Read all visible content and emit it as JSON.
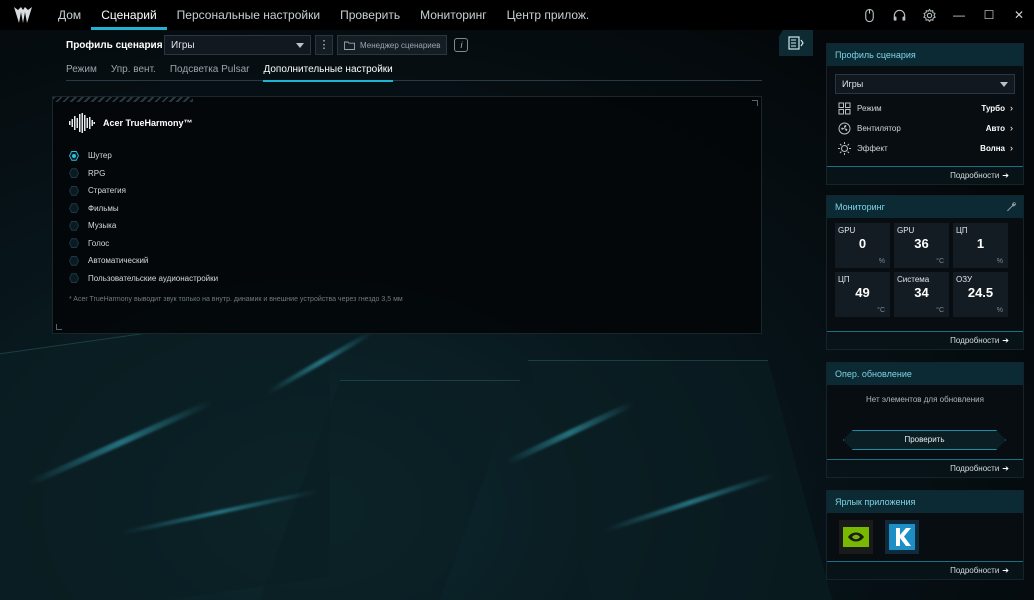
{
  "nav": {
    "items": [
      {
        "label": "Дом",
        "active": false
      },
      {
        "label": "Сценарий",
        "active": true
      },
      {
        "label": "Персональные настройки",
        "active": false
      },
      {
        "label": "Проверить",
        "active": false
      },
      {
        "label": "Мониторинг",
        "active": false
      },
      {
        "label": "Центр прилож.",
        "active": false
      }
    ]
  },
  "window": {
    "minimize": "—",
    "maximize": "☐",
    "close": "✕"
  },
  "profile": {
    "label": "Профиль сценария",
    "selected": "Игры",
    "menu_glyph": "⋮",
    "manager_label": "Менеджер сценариев",
    "info_glyph": "i"
  },
  "subtabs": [
    "Режим",
    "Упр. вент.",
    "Подсветка Pulsar",
    "Дополнительные настройки"
  ],
  "trueharmony": {
    "title": "Acer TrueHarmony™",
    "options": [
      "Шутер",
      "RPG",
      "Стратегия",
      "Фильмы",
      "Музыка",
      "Голос",
      "Автоматический",
      "Пользовательские аудионастройки"
    ],
    "selected_index": 0,
    "footnote": "* Acer TrueHarmony выводит звук только на внутр. динамик и внешние устройства через гнездо 3,5 мм"
  },
  "sidebar": {
    "profile_card": {
      "title": "Профиль сценария",
      "selected": "Игры",
      "rows": [
        {
          "key": "Режим",
          "value": "Турбо",
          "icon": "mode-icon"
        },
        {
          "key": "Вентилятор",
          "value": "Авто",
          "icon": "fan-icon"
        },
        {
          "key": "Эффект",
          "value": "Волна",
          "icon": "effect-icon"
        }
      ],
      "details": "Подробности"
    },
    "monitoring_card": {
      "title": "Мониторинг",
      "cells": [
        {
          "label": "GPU",
          "value": "0",
          "unit": "%"
        },
        {
          "label": "GPU",
          "value": "36",
          "unit": "°C"
        },
        {
          "label": "ЦП",
          "value": "1",
          "unit": "%"
        },
        {
          "label": "ЦП",
          "value": "49",
          "unit": "°C"
        },
        {
          "label": "Система",
          "value": "34",
          "unit": "°C"
        },
        {
          "label": "ОЗУ",
          "value": "24.5",
          "unit": "%"
        }
      ],
      "details": "Подробности"
    },
    "update_card": {
      "title": "Опер. обновление",
      "empty": "Нет элементов для обновления",
      "button": "Проверить",
      "details": "Подробности"
    },
    "shortcut_card": {
      "title": "Ярлык приложения",
      "apps": [
        "nvidia-icon",
        "killer-icon"
      ],
      "details": "Подробности"
    }
  },
  "colors": {
    "accent": "#1fb4d2",
    "card_head": "#0b2a33"
  }
}
